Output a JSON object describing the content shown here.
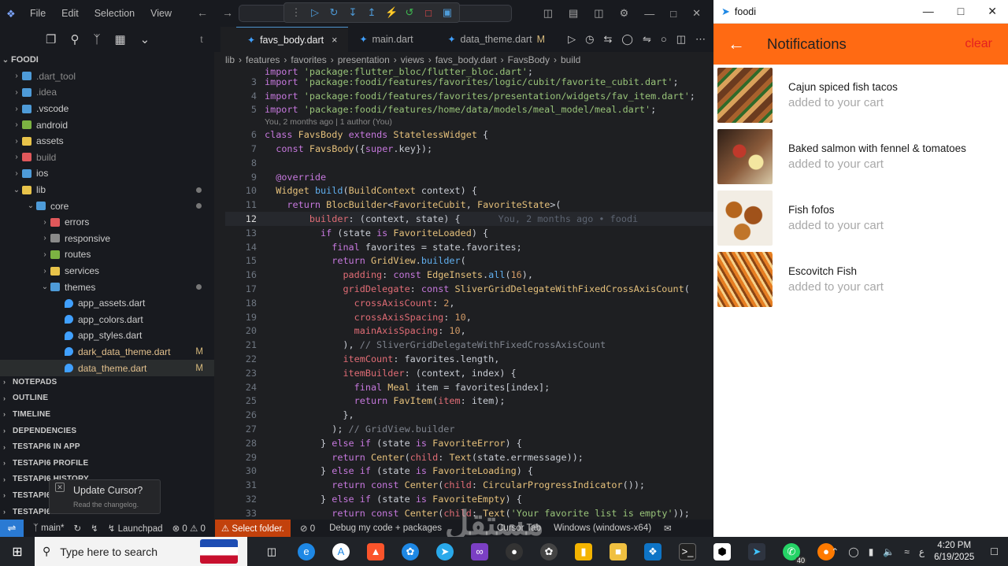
{
  "vscode": {
    "menu": [
      "File",
      "Edit",
      "Selection",
      "View"
    ],
    "tabs": [
      {
        "label": "favs_body.dart",
        "active": true,
        "close": "×"
      },
      {
        "label": "main.dart",
        "active": false
      },
      {
        "label": "data_theme.dart",
        "badge": "M",
        "active": false
      }
    ],
    "breadcrumbs": [
      "lib",
      "features",
      "favorites",
      "presentation",
      "views",
      "favs_body.dart",
      "FavsBody",
      "build"
    ],
    "explorer": {
      "root": "FOODI",
      "items": [
        {
          "label": ".dart_tool",
          "level": 1,
          "color": "#4e9bd8"
        },
        {
          "label": ".idea",
          "level": 1,
          "color": "#4e9bd8"
        },
        {
          "label": ".vscode",
          "level": 1,
          "color": "#4e9bd8"
        },
        {
          "label": "android",
          "level": 1,
          "color": "#7cb342"
        },
        {
          "label": "assets",
          "level": 1,
          "color": "#e8c34a"
        },
        {
          "label": "build",
          "level": 1,
          "color": "#e0585b"
        },
        {
          "label": "ios",
          "level": 1,
          "color": "#4e9bd8"
        },
        {
          "label": "lib",
          "level": 1,
          "color": "#e8c34a",
          "open": true,
          "dot": true
        },
        {
          "label": "core",
          "level": 2,
          "color": "#4e9bd8",
          "open": true,
          "dot": true
        },
        {
          "label": "errors",
          "level": 3,
          "color": "#e0585b"
        },
        {
          "label": "responsive",
          "level": 3,
          "color": "#8a8a8a"
        },
        {
          "label": "routes",
          "level": 3,
          "color": "#7cb342"
        },
        {
          "label": "services",
          "level": 3,
          "color": "#e8c34a"
        },
        {
          "label": "themes",
          "level": 3,
          "color": "#4e9bd8",
          "open": true,
          "dot": true
        },
        {
          "label": "app_assets.dart",
          "level": 4,
          "file": true
        },
        {
          "label": "app_colors.dart",
          "level": 4,
          "file": true
        },
        {
          "label": "app_styles.dart",
          "level": 4,
          "file": true
        },
        {
          "label": "dark_data_theme.dart",
          "level": 4,
          "file": true,
          "mod": "M"
        },
        {
          "label": "data_theme.dart",
          "level": 4,
          "file": true,
          "mod": "M"
        }
      ],
      "sections": [
        "NOTEPADS",
        "OUTLINE",
        "TIMELINE",
        "DEPENDENCIES",
        "TESTAPI6 IN APP",
        "TESTAPI6 PROFILE",
        "TESTAPI6 HISTORY",
        "TESTAPI6",
        "TESTAPI6 LIBRARY"
      ]
    },
    "code": {
      "blame": "You, 2 months ago | 1 author (You)",
      "inline_blame": "You, 2 months ago • foodi",
      "lines": [
        {
          "n": "",
          "t": "import 'package:flutter_bloc/flutter_bloc.dart';"
        },
        {
          "n": "3",
          "t": "import 'package:foodi/features/favorites/logic/cubit/favorite_cubit.dart';"
        },
        {
          "n": "4",
          "t": "import 'package:foodi/features/favorites/presentation/widgets/fav_item.dart';"
        },
        {
          "n": "5",
          "t": "import 'package:foodi/features/home/data/models/meal_model/meal.dart';"
        },
        {
          "n": "6",
          "t": "class FavsBody extends StatelessWidget {"
        },
        {
          "n": "7",
          "t": "  const FavsBody({super.key});"
        },
        {
          "n": "8",
          "t": ""
        },
        {
          "n": "9",
          "t": "  @override"
        },
        {
          "n": "10",
          "t": "  Widget build(BuildContext context) {"
        },
        {
          "n": "11",
          "t": "    return BlocBuilder<FavoriteCubit, FavoriteState>("
        },
        {
          "n": "12",
          "t": "        builder: (context, state) {"
        },
        {
          "n": "13",
          "t": "          if (state is FavoriteLoaded) {"
        },
        {
          "n": "14",
          "t": "            final favorites = state.favorites;"
        },
        {
          "n": "15",
          "t": "            return GridView.builder("
        },
        {
          "n": "16",
          "t": "              padding: const EdgeInsets.all(16),"
        },
        {
          "n": "17",
          "t": "              gridDelegate: const SliverGridDelegateWithFixedCrossAxisCount("
        },
        {
          "n": "18",
          "t": "                crossAxisCount: 2,"
        },
        {
          "n": "19",
          "t": "                crossAxisSpacing: 10,"
        },
        {
          "n": "20",
          "t": "                mainAxisSpacing: 10,"
        },
        {
          "n": "21",
          "t": "              ), // SliverGridDelegateWithFixedCrossAxisCount"
        },
        {
          "n": "22",
          "t": "              itemCount: favorites.length,"
        },
        {
          "n": "23",
          "t": "              itemBuilder: (context, index) {"
        },
        {
          "n": "24",
          "t": "                final Meal item = favorites[index];"
        },
        {
          "n": "25",
          "t": "                return FavItem(item: item);"
        },
        {
          "n": "26",
          "t": "              },"
        },
        {
          "n": "27",
          "t": "            ); // GridView.builder"
        },
        {
          "n": "28",
          "t": "          } else if (state is FavoriteError) {"
        },
        {
          "n": "29",
          "t": "            return Center(child: Text(state.errmessage));"
        },
        {
          "n": "30",
          "t": "          } else if (state is FavoriteLoading) {"
        },
        {
          "n": "31",
          "t": "            return const Center(child: CircularProgressIndicator());"
        },
        {
          "n": "32",
          "t": "          } else if (state is FavoriteEmpty) {"
        },
        {
          "n": "33",
          "t": "            return const Center(child: Text('Your favorite list is empty'));"
        }
      ]
    },
    "status": {
      "branch": "main*",
      "launchpad": "Launchpad",
      "problems": "⊗ 0 ⚠ 0",
      "select_folder": "⚠ Select folder.",
      "ports": "⊘ 0",
      "debug": "Debug my code + packages",
      "cursor_tab": "Cursor Tab",
      "platform": "Windows (windows-x64)"
    },
    "toast": {
      "title": "Update Cursor?",
      "sub": "Read the changelog."
    }
  },
  "app": {
    "window_title": "foodi",
    "appbar_title": "Notifications",
    "clear_label": "clear",
    "notifications": [
      {
        "name": "Cajun spiced fish tacos",
        "sub": "added to your cart"
      },
      {
        "name": "Baked salmon with fennel & tomatoes",
        "sub": "added to your cart"
      },
      {
        "name": "Fish fofos",
        "sub": "added to your cart"
      },
      {
        "name": "Escovitch Fish",
        "sub": "added to your cart"
      }
    ],
    "accent": "#ff6a13"
  },
  "taskbar": {
    "search_placeholder": "Type here to search",
    "time": "4:20 PM",
    "date": "6/19/2025",
    "whatsapp_badge": "40",
    "lang": "ع"
  },
  "watermark": {
    "main": "مستقل",
    "sub": "mostaql.com"
  }
}
